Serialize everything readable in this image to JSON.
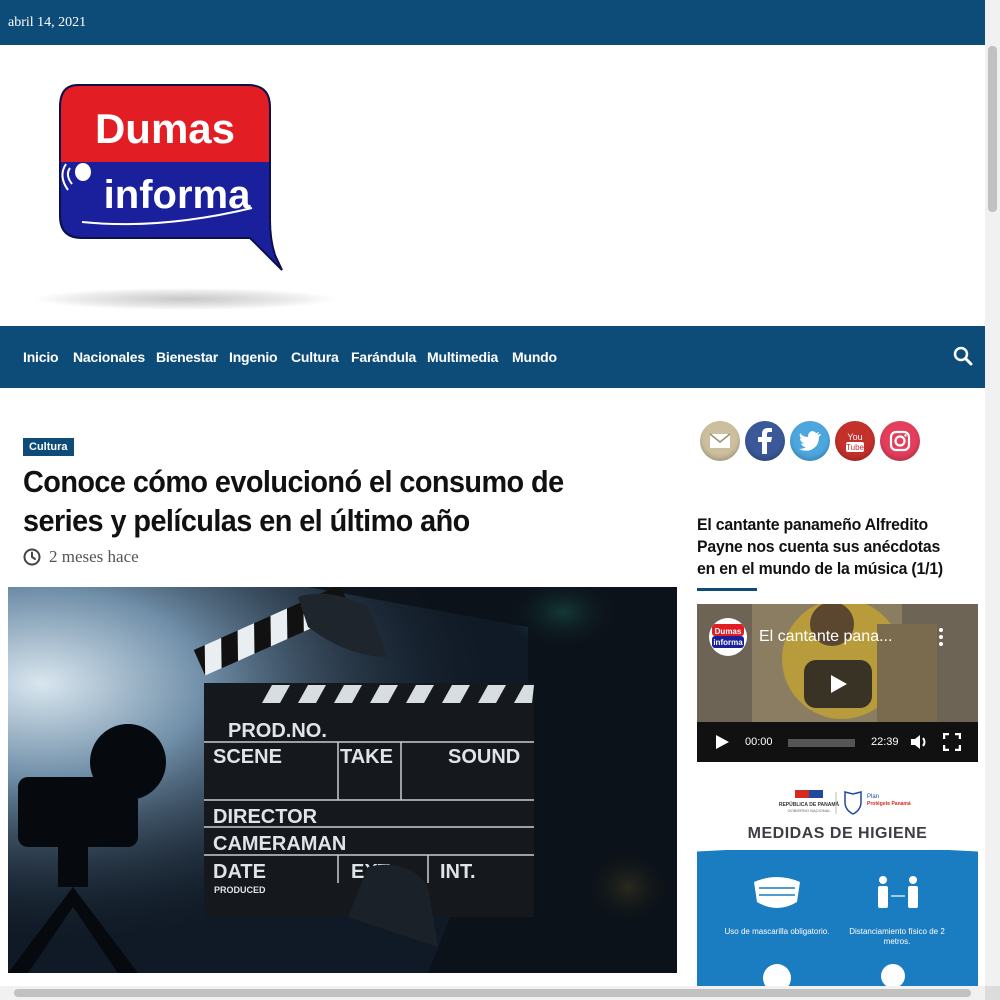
{
  "topbar": {
    "date": "abril 14, 2021"
  },
  "logo": {
    "line1": "Dumas",
    "line2": "informa"
  },
  "nav": {
    "items": [
      "Inicio",
      "Nacionales",
      "Bienestar",
      "Ingenio",
      "Cultura",
      "Farándula",
      "Multimedia",
      "Mundo"
    ]
  },
  "article": {
    "category": "Cultura",
    "title": "Conoce cómo evolucionó el consumo de series y películas en el último año",
    "time_ago": "2 meses hace",
    "image": {
      "slate_prod": "PROD.NO.",
      "slate_scene": "SCENE",
      "slate_take": "TAKE",
      "slate_sound": "SOUND",
      "slate_director": "DIRECTOR",
      "slate_cameraman": "CAMERAMAN",
      "slate_date": "DATE",
      "slate_ext": "EXT.",
      "slate_int": "INT.",
      "slate_produced": "PRODUCED"
    }
  },
  "sidebar": {
    "social": [
      "email-icon",
      "facebook-icon",
      "twitter-icon",
      "youtube-icon",
      "instagram-icon"
    ],
    "colors": {
      "brand": "#0d4c79",
      "red": "#e21d24",
      "blue": "#1a1f9c"
    },
    "post_title": "El cantante panameño Alfredito Payne nos cuenta sus anécdotas en en el mundo de la música (1/1)",
    "video": {
      "title": "El cantante pana...",
      "current_time": "00:00",
      "duration": "22:39",
      "progress": 0
    },
    "ad": {
      "header_left": "REPÚBLICA DE PANAMÁ",
      "header_sub": "GOBIERNO NACIONAL",
      "plan_label": "Plan",
      "plan_name": "Protégete Panamá",
      "title": "MEDIDAS DE HIGIENE",
      "item1": "Uso de mascarilla obligatorio.",
      "item2": "Distanciamiento físico de 2 metros."
    }
  }
}
